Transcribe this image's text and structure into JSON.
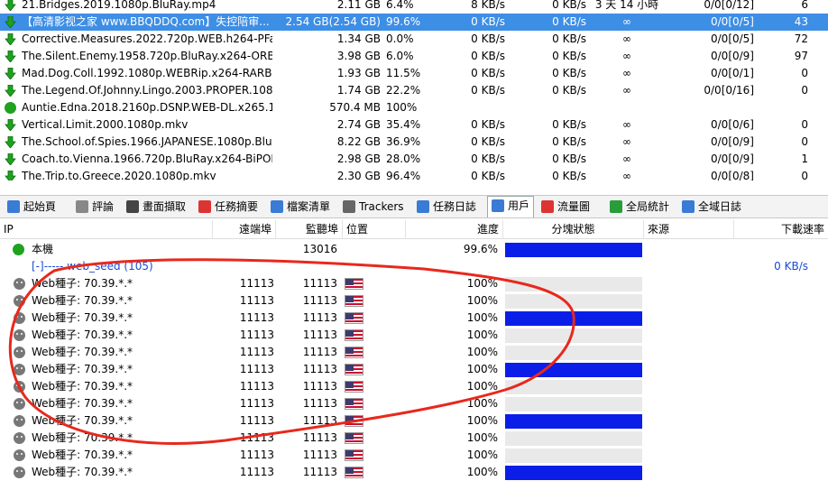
{
  "tasks": [
    {
      "name": "21.Bridges.2019.1080p.BluRay.mp4",
      "size": "2.11 GB",
      "pct": "6.4%",
      "dl": "8 KB/s",
      "ul": "0 KB/s",
      "eta": "3 天 14 小時",
      "peers": "0/0[0/12]",
      "avail": "6",
      "status": "down",
      "selected": false
    },
    {
      "name": "【高清影视之家 www.BBQDDQ.com】失控陪审...",
      "size": "2.54 GB(2.54 GB)",
      "pct": "99.6%",
      "dl": "0 KB/s",
      "ul": "0 KB/s",
      "eta": "∞",
      "peers": "0/0[0/5]",
      "avail": "43",
      "status": "down",
      "selected": true
    },
    {
      "name": "Corrective.Measures.2022.720p.WEB.h264-PFa[...",
      "size": "1.34 GB",
      "pct": "0.0%",
      "dl": "0 KB/s",
      "ul": "0 KB/s",
      "eta": "∞",
      "peers": "0/0[0/5]",
      "avail": "72",
      "status": "down",
      "selected": false
    },
    {
      "name": "The.Silent.Enemy.1958.720p.BluRay.x264-ORBS...",
      "size": "3.98 GB",
      "pct": "6.0%",
      "dl": "0 KB/s",
      "ul": "0 KB/s",
      "eta": "∞",
      "peers": "0/0[0/9]",
      "avail": "97",
      "status": "down",
      "selected": false
    },
    {
      "name": "Mad.Dog.Coll.1992.1080p.WEBRip.x264-RARBG",
      "size": "1.93 GB",
      "pct": "11.5%",
      "dl": "0 KB/s",
      "ul": "0 KB/s",
      "eta": "∞",
      "peers": "0/0[0/1]",
      "avail": "0",
      "status": "down",
      "selected": false
    },
    {
      "name": "The.Legend.Of.Johnny.Lingo.2003.PROPER.108...",
      "size": "1.74 GB",
      "pct": "22.2%",
      "dl": "0 KB/s",
      "ul": "0 KB/s",
      "eta": "∞",
      "peers": "0/0[0/16]",
      "avail": "0",
      "status": "down",
      "selected": false
    },
    {
      "name": "Auntie.Edna.2018.2160p.DSNP.WEB-DL.x265.1...",
      "size": "570.4 MB",
      "pct": "100%",
      "dl": "",
      "ul": "",
      "eta": "",
      "peers": "",
      "avail": "",
      "status": "done",
      "selected": false
    },
    {
      "name": "Vertical.Limit.2000.1080p.mkv",
      "size": "2.74 GB",
      "pct": "35.4%",
      "dl": "0 KB/s",
      "ul": "0 KB/s",
      "eta": "∞",
      "peers": "0/0[0/6]",
      "avail": "0",
      "status": "down",
      "selected": false
    },
    {
      "name": "The.School.of.Spies.1966.JAPANESE.1080p.Blu...",
      "size": "8.22 GB",
      "pct": "36.9%",
      "dl": "0 KB/s",
      "ul": "0 KB/s",
      "eta": "∞",
      "peers": "0/0[0/9]",
      "avail": "0",
      "status": "down",
      "selected": false
    },
    {
      "name": "Coach.to.Vienna.1966.720p.BluRay.x264-BiPOL...",
      "size": "2.98 GB",
      "pct": "28.0%",
      "dl": "0 KB/s",
      "ul": "0 KB/s",
      "eta": "∞",
      "peers": "0/0[0/9]",
      "avail": "1",
      "status": "down",
      "selected": false
    },
    {
      "name": "The.Trip.to.Greece.2020.1080p.mkv",
      "size": "2.30 GB",
      "pct": "96.4%",
      "dl": "0 KB/s",
      "ul": "0 KB/s",
      "eta": "∞",
      "peers": "0/0[0/8]",
      "avail": "0",
      "status": "down",
      "selected": false
    }
  ],
  "tabs": [
    {
      "label": "起始頁",
      "icon": "home-icon",
      "color": "#3a7bd5"
    },
    {
      "label": "評論",
      "icon": "comment-icon",
      "color": "#888"
    },
    {
      "label": "畫面擷取",
      "icon": "screenshot-icon",
      "color": "#444"
    },
    {
      "label": "任務摘要",
      "icon": "summary-icon",
      "color": "#d33"
    },
    {
      "label": "檔案清單",
      "icon": "files-icon",
      "color": "#3a7bd5"
    },
    {
      "label": "Trackers",
      "icon": "trackers-icon",
      "color": "#666"
    },
    {
      "label": "任務日誌",
      "icon": "log-icon",
      "color": "#3a7bd5"
    },
    {
      "label": "用戶",
      "icon": "users-icon",
      "color": "#3a7bd5",
      "active": true
    },
    {
      "label": "流量圖",
      "icon": "graph-icon",
      "color": "#d33"
    },
    {
      "label": "全局統計",
      "icon": "stats-icon",
      "color": "#2a9d3a"
    },
    {
      "label": "全域日誌",
      "icon": "global-log-icon",
      "color": "#3a7bd5"
    }
  ],
  "peers_header": {
    "ip": "IP",
    "port": "遠端埠",
    "listen": "監聽埠",
    "location": "位置",
    "progress": "進度",
    "pieces": "分塊狀態",
    "source": "來源",
    "rate": "下載速率"
  },
  "local": {
    "label": "本機",
    "listen": "13016",
    "progress": "99.6%"
  },
  "web_seed_group": {
    "label": "[-]----- web_seed (105)",
    "rate": "0 KB/s"
  },
  "peers": [
    {
      "ip": "Web種子: 70.39.*.*",
      "port": "11113",
      "listen": "11113",
      "progress": "100%",
      "fill": 0
    },
    {
      "ip": "Web種子: 70.39.*.*",
      "port": "11113",
      "listen": "11113",
      "progress": "100%",
      "fill": 0
    },
    {
      "ip": "Web種子: 70.39.*.*",
      "port": "11113",
      "listen": "11113",
      "progress": "100%",
      "fill": 1
    },
    {
      "ip": "Web種子: 70.39.*.*",
      "port": "11113",
      "listen": "11113",
      "progress": "100%",
      "fill": 0
    },
    {
      "ip": "Web種子: 70.39.*.*",
      "port": "11113",
      "listen": "11113",
      "progress": "100%",
      "fill": 0
    },
    {
      "ip": "Web種子: 70.39.*.*",
      "port": "11113",
      "listen": "11113",
      "progress": "100%",
      "fill": 1
    },
    {
      "ip": "Web種子: 70.39.*.*",
      "port": "11113",
      "listen": "11113",
      "progress": "100%",
      "fill": 0
    },
    {
      "ip": "Web種子: 70.39.*.*",
      "port": "11113",
      "listen": "11113",
      "progress": "100%",
      "fill": 0
    },
    {
      "ip": "Web種子: 70.39.*.*",
      "port": "11113",
      "listen": "11113",
      "progress": "100%",
      "fill": 1
    },
    {
      "ip": "Web種子: 70.39.*.*",
      "port": "11113",
      "listen": "11113",
      "progress": "100%",
      "fill": 0
    },
    {
      "ip": "Web種子: 70.39.*.*",
      "port": "11113",
      "listen": "11113",
      "progress": "100%",
      "fill": 0
    },
    {
      "ip": "Web種子: 70.39.*.*",
      "port": "11113",
      "listen": "11113",
      "progress": "100%",
      "fill": 1
    }
  ]
}
